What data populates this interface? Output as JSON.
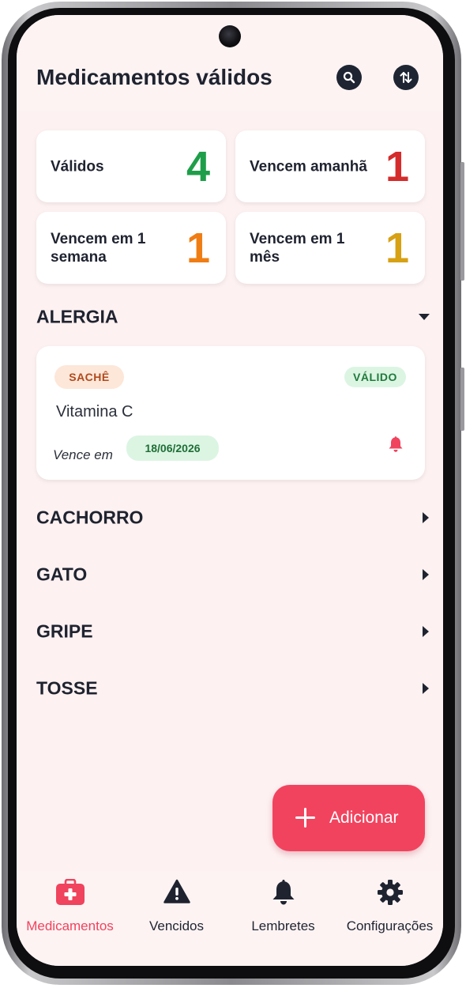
{
  "header": {
    "title": "Medicamentos válidos",
    "search_icon": "search-icon",
    "sort_icon": "sort-icon"
  },
  "stats": [
    {
      "label": "Válidos",
      "value": "4",
      "color": "#1f9e4a"
    },
    {
      "label": "Vencem amanhã",
      "value": "1",
      "color": "#d42c2c"
    },
    {
      "label": "Vencem em 1 semana",
      "value": "1",
      "color": "#ef7d14"
    },
    {
      "label": "Vencem em 1 mês",
      "value": "1",
      "color": "#d7a114"
    }
  ],
  "groups": [
    {
      "name": "ALERGIA",
      "expanded": true,
      "items": [
        {
          "type_badge": "SACHÊ",
          "status_badge": "VÁLIDO",
          "name": "Vitamina C",
          "expire_label": "Vence em",
          "expire_date": "18/06/2026"
        }
      ]
    },
    {
      "name": "CACHORRO",
      "expanded": false
    },
    {
      "name": "GATO",
      "expanded": false
    },
    {
      "name": "GRIPE",
      "expanded": false
    },
    {
      "name": "TOSSE",
      "expanded": false
    }
  ],
  "fab": {
    "label": "Adicionar"
  },
  "nav": [
    {
      "label": "Medicamentos",
      "icon": "medical-kit-icon",
      "active": true
    },
    {
      "label": "Vencidos",
      "icon": "warning-icon",
      "active": false
    },
    {
      "label": "Lembretes",
      "icon": "bell-icon",
      "active": false
    },
    {
      "label": "Configurações",
      "icon": "gear-icon",
      "active": false
    }
  ],
  "colors": {
    "accent": "#f2435e",
    "background": "#fdf1f1",
    "dark": "#1f2330"
  }
}
